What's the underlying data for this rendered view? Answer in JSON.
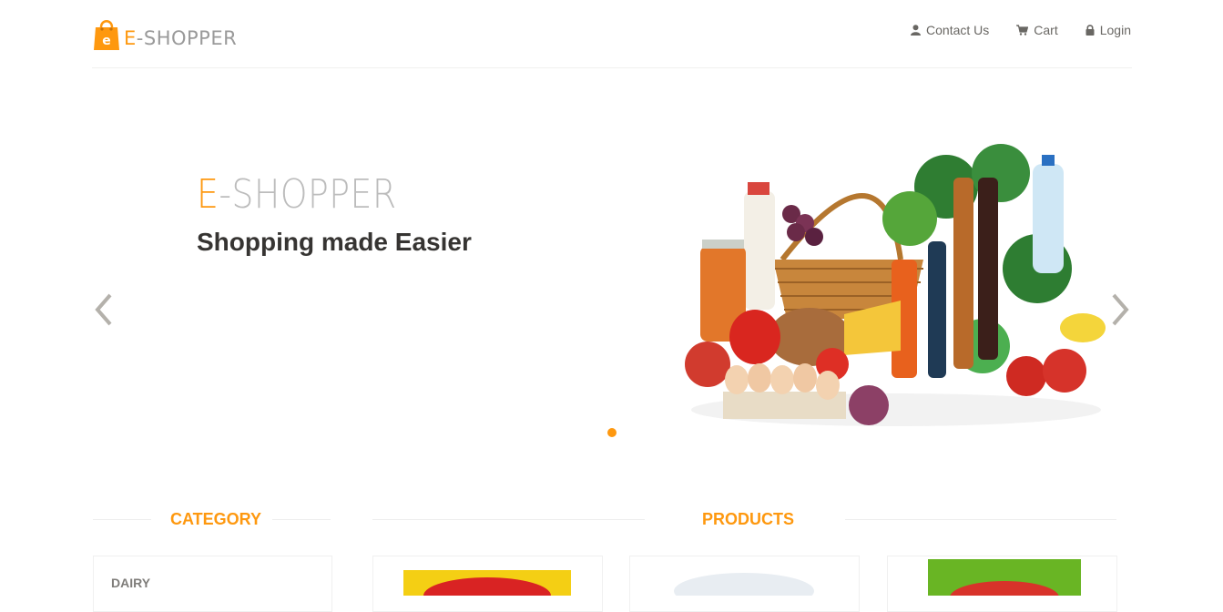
{
  "header": {
    "logo": {
      "prefix": "E",
      "rest": "-SHOPPER",
      "bag_letter": "e"
    },
    "nav": [
      {
        "label": "Contact Us",
        "icon": "user-icon"
      },
      {
        "label": "Cart",
        "icon": "shopping-cart-icon"
      },
      {
        "label": "Login",
        "icon": "lock-icon"
      }
    ]
  },
  "slider": {
    "title_prefix": "E",
    "title_rest": "-SHOPPER",
    "subtitle": "Shopping made Easier",
    "image": "grocery-basket-image",
    "indicator_count": 1,
    "active_index": 0,
    "prev_icon": "chevron-left-icon",
    "next_icon": "chevron-right-icon"
  },
  "sections": {
    "category_title": "CATEGORY",
    "products_title": "PRODUCTS"
  },
  "categories": [
    {
      "label": "DAIRY"
    }
  ],
  "products": [
    {
      "image": "yellow-snack-pack-image"
    },
    {
      "image": "white-tub-image"
    },
    {
      "image": "green-chips-bag-image"
    }
  ],
  "colors": {
    "accent": "#FE980F",
    "text_dark": "#363432",
    "text_muted": "#696763",
    "logo_grey": "#9a9a9a"
  }
}
